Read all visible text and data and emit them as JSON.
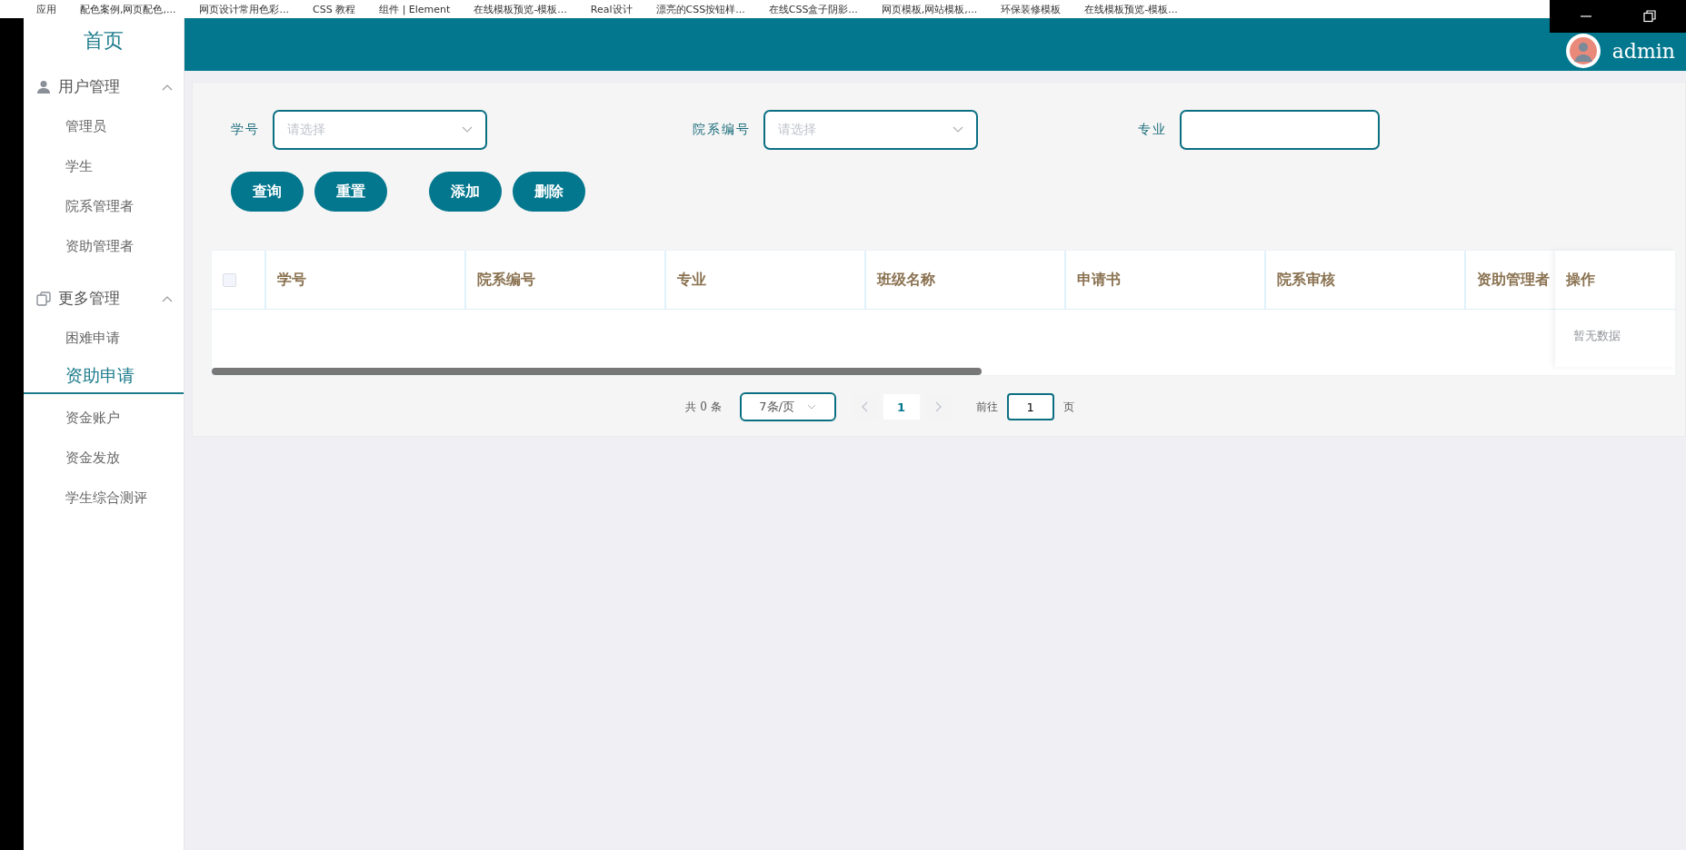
{
  "bookmarks": [
    "应用",
    "配色案例,网页配色,...",
    "网页设计常用色彩...",
    "CSS 教程",
    "组件 | Element",
    "在线模板预览-模板...",
    "Real设计",
    "漂亮的CSS按钮样...",
    "在线CSS盒子阴影...",
    "网页模板,网站模板,...",
    "环保装修模板",
    "在线模板预览-模板..."
  ],
  "sidebar": {
    "home": "首页",
    "groups": [
      {
        "title": "用户管理",
        "expanded": true,
        "items": [
          {
            "label": "管理员",
            "selected": false
          },
          {
            "label": "学生",
            "selected": false
          },
          {
            "label": "院系管理者",
            "selected": false
          },
          {
            "label": "资助管理者",
            "selected": false
          }
        ]
      },
      {
        "title": "更多管理",
        "expanded": true,
        "items": [
          {
            "label": "困难申请",
            "selected": false
          },
          {
            "label": "资助申请",
            "selected": true
          },
          {
            "label": "资金账户",
            "selected": false
          },
          {
            "label": "资金发放",
            "selected": false
          },
          {
            "label": "学生综合测评",
            "selected": false
          }
        ]
      }
    ]
  },
  "header": {
    "user": "admin"
  },
  "filters": [
    {
      "label": "学号",
      "kind": "select",
      "placeholder": "请选择"
    },
    {
      "label": "院系编号",
      "kind": "select",
      "placeholder": "请选择"
    },
    {
      "label": "专业",
      "kind": "input"
    }
  ],
  "buttons": [
    "查询",
    "重置",
    "添加",
    "删除"
  ],
  "table": {
    "select_all": {
      "checked": false
    },
    "columns": [
      "学号",
      "院系编号",
      "专业",
      "班级名称",
      "申请书",
      "院系审核",
      "资助管理者"
    ],
    "fixed_column": "操作",
    "empty_text": "暂无数据"
  },
  "pagination": {
    "total": "共 0 条",
    "page_size": "7条/页",
    "pages": [
      {
        "label": "1",
        "selected": true
      }
    ],
    "goto_label": "前往",
    "goto_value": "1",
    "goto_suffix": "页"
  }
}
